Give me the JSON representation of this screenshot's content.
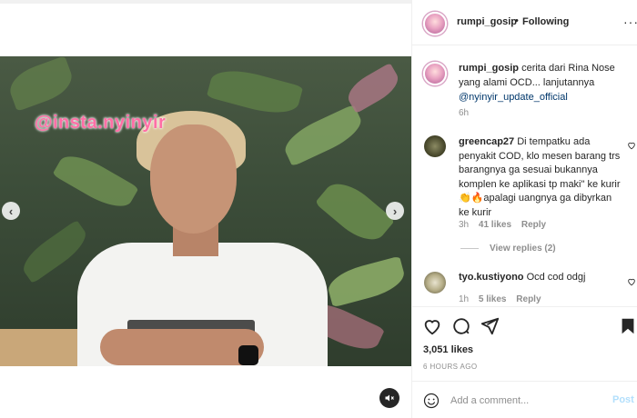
{
  "media": {
    "watermark": "@insta.nyinyir",
    "prev_glyph": "‹",
    "next_glyph": "›",
    "mute_icon": "speaker-muted-icon"
  },
  "header": {
    "username": "rumpi_gosip",
    "separator": "•",
    "follow_status": "Following",
    "more_glyph": "···"
  },
  "caption": {
    "username": "rumpi_gosip",
    "text": "cerita dari Rina Nose yang alami OCD... lanjutannya",
    "mention": "@nyinyir_update_official",
    "time": "6h"
  },
  "comments": [
    {
      "username": "greencap27",
      "text": "Di tempatku ada penyakit COD, klo mesen barang trs barangnya ga sesuai bukannya komplen ke aplikasi tp maki\" ke kurir 👏🔥apalagi uangnya ga dibyrkan ke kurir",
      "time": "3h",
      "likes": "41 likes",
      "reply": "Reply",
      "view_replies": "View replies (2)"
    },
    {
      "username": "tyo.kustiyono",
      "text": "Ocd cod odgj",
      "time": "1h",
      "likes": "5 likes",
      "reply": "Reply"
    }
  ],
  "actions": {
    "likes": "3,051 likes",
    "posted": "6 HOURS AGO"
  },
  "add_comment": {
    "placeholder": "Add a comment...",
    "post_label": "Post"
  },
  "colors": {
    "link": "#00376b",
    "muted": "#8e8e8e",
    "post_disabled": "#b2dffc",
    "watermark": "#ff6fa6"
  }
}
